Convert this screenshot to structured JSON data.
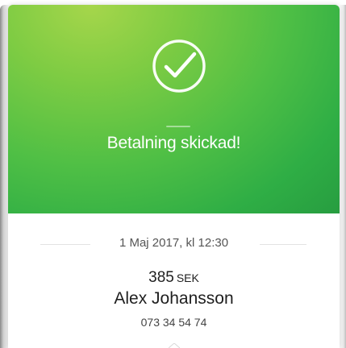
{
  "colors": {
    "hero_light": "#a6d64b",
    "hero_mid": "#4fbf45",
    "hero_dark": "#279d40",
    "white": "#ffffff",
    "text_dark": "#1e1e1e",
    "text_muted": "#555555"
  },
  "hero": {
    "icon": "checkmark-circle-icon",
    "title": "Betalning skickad!"
  },
  "details": {
    "datetime": "1 Maj 2017, kl 12:30",
    "amount": "385",
    "currency": "SEK",
    "recipient_name": "Alex Johansson",
    "recipient_phone": "073 34 54 74"
  }
}
